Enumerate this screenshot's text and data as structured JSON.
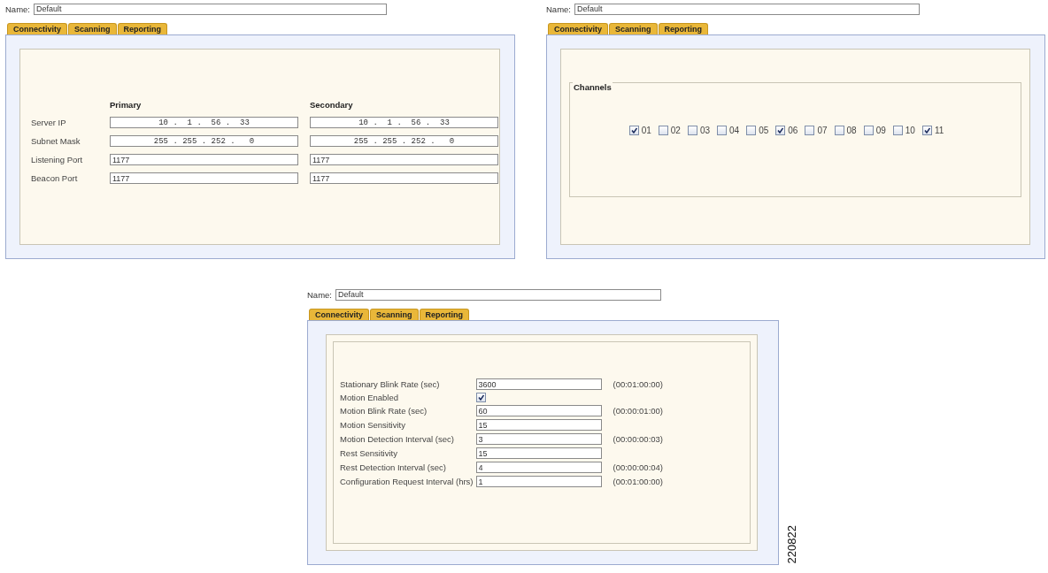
{
  "panels": [
    {
      "kind": "connectivity",
      "name_label": "Name:",
      "name_value": "Default",
      "tabs": [
        "Connectivity",
        "Scanning",
        "Reporting"
      ],
      "columns": [
        "Primary",
        "Secondary"
      ],
      "rows": [
        {
          "label": "Server IP",
          "kind": "ip",
          "primary": "10 .  1 .  56 .  33",
          "secondary": "10 .  1 .  56 .  33"
        },
        {
          "label": "Subnet Mask",
          "kind": "ip",
          "primary": "255 . 255 . 252 .   0",
          "secondary": "255 . 255 . 252 .   0"
        },
        {
          "label": "Listening Port",
          "kind": "text",
          "primary": "1177",
          "secondary": "1177"
        },
        {
          "label": "Beacon Port",
          "kind": "text",
          "primary": "1177",
          "secondary": "1177"
        }
      ]
    },
    {
      "kind": "scanning",
      "name_label": "Name:",
      "name_value": "Default",
      "tabs": [
        "Connectivity",
        "Scanning",
        "Reporting"
      ],
      "group_title": "Channels",
      "channels": [
        {
          "label": "01",
          "checked": true
        },
        {
          "label": "02",
          "checked": false
        },
        {
          "label": "03",
          "checked": false
        },
        {
          "label": "04",
          "checked": false
        },
        {
          "label": "05",
          "checked": false
        },
        {
          "label": "06",
          "checked": true
        },
        {
          "label": "07",
          "checked": false
        },
        {
          "label": "08",
          "checked": false
        },
        {
          "label": "09",
          "checked": false
        },
        {
          "label": "10",
          "checked": false
        },
        {
          "label": "11",
          "checked": true
        }
      ]
    },
    {
      "kind": "reporting",
      "name_label": "Name:",
      "name_value": "Default",
      "tabs": [
        "Connectivity",
        "Scanning",
        "Reporting"
      ],
      "rows": [
        {
          "kind": "field",
          "label": "Stationary Blink Rate (sec)",
          "value": "3600",
          "note": "(00:01:00:00)"
        },
        {
          "kind": "checkbox",
          "label": "Motion Enabled",
          "checked": true
        },
        {
          "kind": "field",
          "label": "Motion Blink Rate (sec)",
          "value": "60",
          "note": "(00:00:01:00)"
        },
        {
          "kind": "field",
          "label": "Motion Sensitivity",
          "value": "15"
        },
        {
          "kind": "field",
          "label": "Motion Detection Interval (sec)",
          "value": "3",
          "note": "(00:00:00:03)"
        },
        {
          "kind": "field",
          "label": "Rest Sensitivity",
          "value": "15"
        },
        {
          "kind": "field",
          "label": "Rest Detection Interval (sec)",
          "value": "4",
          "note": "(00:00:00:04)"
        },
        {
          "kind": "field",
          "label": "Configuration Request Interval (hrs)",
          "value": "1",
          "note": "(00:01:00:00)"
        }
      ]
    }
  ],
  "figure_id": "220822"
}
